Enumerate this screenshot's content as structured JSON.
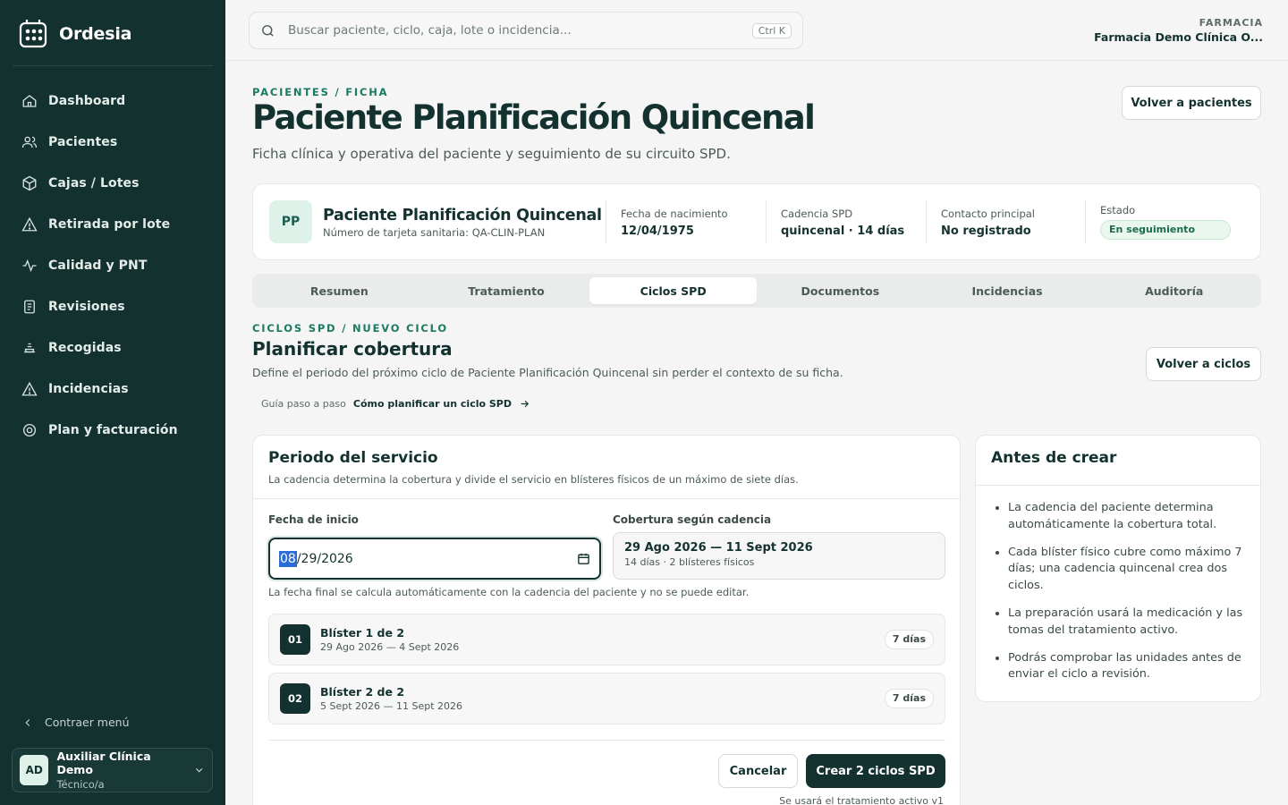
{
  "brand": {
    "name": "Ordesia"
  },
  "sidebar": {
    "items": [
      {
        "label": "Dashboard",
        "icon": "home-icon"
      },
      {
        "label": "Pacientes",
        "icon": "users-icon"
      },
      {
        "label": "Cajas / Lotes",
        "icon": "box-icon"
      },
      {
        "label": "Retirada por lote",
        "icon": "alert-triangle-icon"
      },
      {
        "label": "Calidad y PNT",
        "icon": "activity-icon"
      },
      {
        "label": "Revisiones",
        "icon": "clipboard-icon"
      },
      {
        "label": "Recogidas",
        "icon": "pickup-icon"
      },
      {
        "label": "Incidencias",
        "icon": "alert-triangle-icon"
      },
      {
        "label": "Plan y facturación",
        "icon": "settings-icon"
      }
    ],
    "collapse_label": "Contraer menú",
    "user": {
      "initials": "AD",
      "name": "Auxiliar Clínica Demo",
      "role": "Técnico/a"
    }
  },
  "topbar": {
    "search_placeholder": "Buscar paciente, ciclo, caja, lote o incidencia...",
    "search_shortcut": "Ctrl K",
    "pharmacy_label": "FARMACIA",
    "pharmacy_name": "Farmacia Demo Clínica O..."
  },
  "page": {
    "breadcrumb": "PACIENTES / FICHA",
    "title": "Paciente Planificación Quincenal",
    "subtitle": "Ficha clínica y operativa del paciente y seguimiento de su circuito SPD.",
    "back_button": "Volver a pacientes"
  },
  "patient": {
    "initials": "PP",
    "name": "Paciente Planificación Quincenal",
    "card_number": "Número de tarjeta sanitaria: QA-CLIN-PLAN",
    "fields": [
      {
        "label": "Fecha de nacimiento",
        "value": "12/04/1975"
      },
      {
        "label": "Cadencia SPD",
        "value": "quincenal · 14 días"
      },
      {
        "label": "Contacto principal",
        "value": "No registrado"
      }
    ],
    "status_label": "Estado",
    "status_value": "En seguimiento"
  },
  "tabs": [
    {
      "label": "Resumen",
      "active": false
    },
    {
      "label": "Tratamiento",
      "active": false
    },
    {
      "label": "Ciclos SPD",
      "active": true
    },
    {
      "label": "Documentos",
      "active": false
    },
    {
      "label": "Incidencias",
      "active": false
    },
    {
      "label": "Auditoría",
      "active": false
    }
  ],
  "section": {
    "breadcrumb": "CICLOS SPD / NUEVO CICLO",
    "title": "Planificar cobertura",
    "subtitle": "Define el periodo del próximo ciclo de Paciente Planificación Quincenal sin perder el contexto de su ficha.",
    "back_button": "Volver a ciclos",
    "guide_label": "Guía paso a paso",
    "guide_link": "Cómo planificar un ciclo SPD"
  },
  "period": {
    "title": "Periodo del servicio",
    "subtitle": "La cadencia determina la cobertura y divide el servicio en blísteres físicos de un máximo de siete días.",
    "start_label": "Fecha de inicio",
    "start_month": "08",
    "start_rest": "/29/2026",
    "coverage_label": "Cobertura según cadencia",
    "coverage_range": "29 Ago 2026 — 11 Sept 2026",
    "coverage_detail": "14 días · 2 blísteres físicos",
    "help": "La fecha final se calcula automáticamente con la cadencia del paciente y no se puede editar.",
    "blisters": [
      {
        "num": "01",
        "title": "Blíster 1 de 2",
        "dates": "29 Ago 2026 — 4 Sept 2026",
        "days": "7 días"
      },
      {
        "num": "02",
        "title": "Blíster 2 de 2",
        "dates": "5 Sept 2026 — 11 Sept 2026",
        "days": "7 días"
      }
    ],
    "cancel_button": "Cancelar",
    "create_button": "Crear 2 ciclos SPD",
    "footnote": "Se usará el tratamiento activo v1"
  },
  "before": {
    "title": "Antes de crear",
    "items": [
      "La cadencia del paciente determina automáticamente la cobertura total.",
      "Cada blíster físico cubre como máximo 7 días; una cadencia quincenal crea dos ciclos.",
      "La preparación usará la medicación y las tomas del tratamiento activo.",
      "Podrás comprobar las unidades antes de enviar el ciclo a revisión."
    ]
  },
  "colors": {
    "sidebar": "#13322f",
    "accent": "#1b7a62",
    "primary_button": "#13322f",
    "background": "#f4f5f4"
  }
}
